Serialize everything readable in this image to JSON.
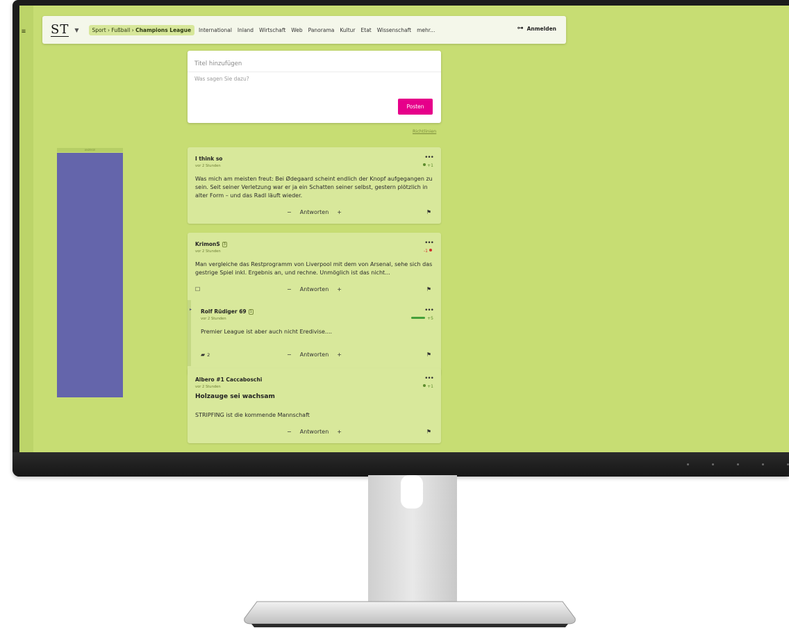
{
  "nav": {
    "logo": "ST",
    "breadcrumb": {
      "parts": "Sport › Fußball › ",
      "current": "Champions League"
    },
    "links": [
      "International",
      "Inland",
      "Wirtschaft",
      "Web",
      "Panorama",
      "Kultur",
      "Etat",
      "Wissenschaft",
      "mehr..."
    ],
    "login": "Anmelden"
  },
  "form": {
    "title_placeholder": "Titel hinzufügen",
    "body_placeholder": "Was sagen Sie dazu?",
    "post_button": "Posten",
    "guidelines": "Richtlinien"
  },
  "ad": {
    "label": "ANZEIGE"
  },
  "posts": [
    {
      "author": "I think so",
      "time": "vor 2 Stunden",
      "rating": "+1",
      "text": "Was mich am meisten freut: Bei Ødegaard scheint endlich der Knopf aufgegangen zu sein. Seit seiner Verletzung war er ja ein Schatten seiner selbst, gestern plötzlich in alter Form – und das Radl läuft wieder.",
      "minus": "−",
      "reply": "Antworten",
      "plus": "+"
    },
    {
      "author": "KrimonS",
      "badge": "3",
      "time": "vor 2 Stunden",
      "rating": "-1",
      "text": "Man vergleiche das Restprogramm von Liverpool mit dem von Arsenal, sehe sich das gestrige Spiel inkl. Ergebnis an, und rechne. Unmöglich ist das nicht...",
      "minus": "−",
      "reply": "Antworten",
      "plus": "+"
    },
    {
      "author": "Rolf Rüdiger 69",
      "badge": "1",
      "time": "vor 2 Stunden",
      "rating": "+5",
      "text": "Premier League ist aber auch nicht Eredivise....",
      "reply_count": "2",
      "minus": "−",
      "reply": "Antworten",
      "plus": "+"
    },
    {
      "author": "Albero #1 Caccaboschi",
      "time": "vor 2 Stunden",
      "rating": "+1",
      "headline": "Holzauge sei wachsam",
      "text": "STRIPFING ist die kommende Mannschaft",
      "minus": "−",
      "reply": "Antworten",
      "plus": "+"
    }
  ],
  "colors": {
    "page_bg": "#c7dd73",
    "post_bg": "#d8e89b",
    "accent": "#e6008a",
    "ad": "#6465ab"
  }
}
